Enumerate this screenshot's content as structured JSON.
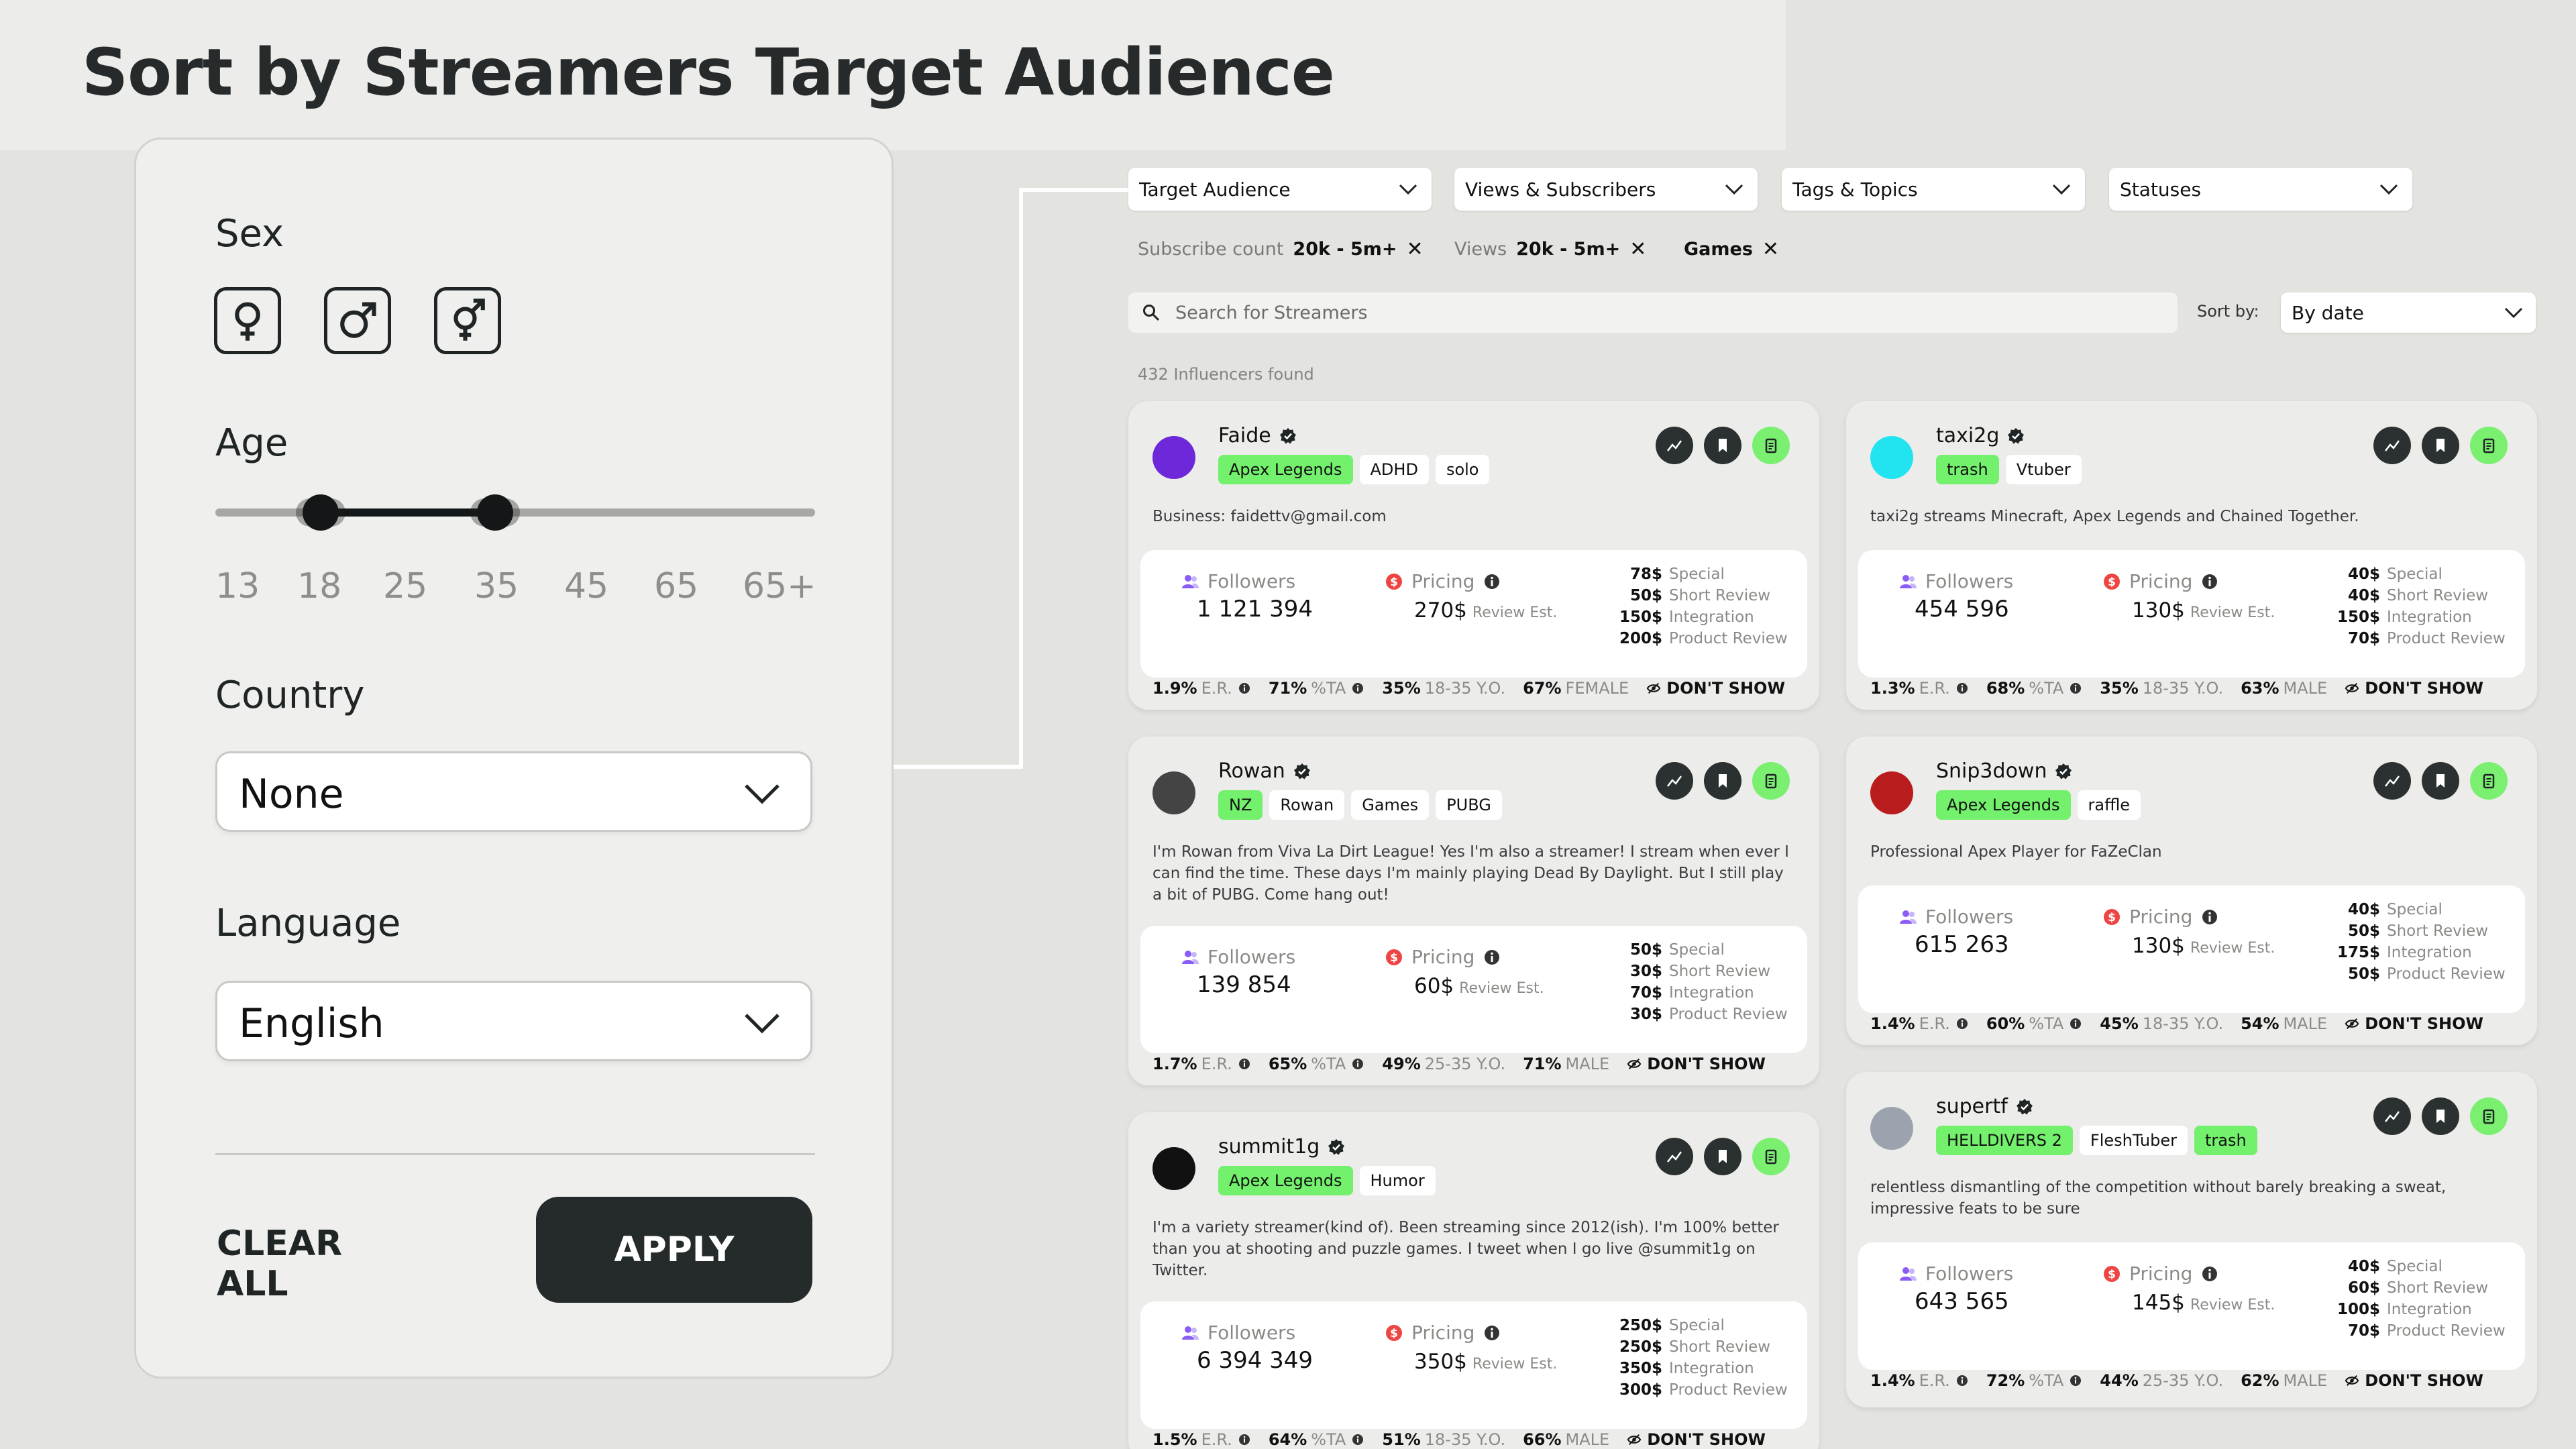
{
  "header": {
    "title": "Sort by Streamers Target Audience"
  },
  "filter_panel": {
    "sex_label": "Sex",
    "age_label": "Age",
    "age_ticks": [
      "13",
      "18",
      "25",
      "35",
      "45",
      "65",
      "65+"
    ],
    "age_range": [
      "18",
      "35"
    ],
    "country_label": "Country",
    "country_value": "None",
    "language_label": "Language",
    "language_value": "English",
    "clear_label": "CLEAR ALL",
    "apply_label": "APPLY"
  },
  "toolbar": {
    "dropdowns": [
      "Target Audience",
      "Views & Subscribers",
      "Tags & Topics",
      "Statuses"
    ],
    "chips": [
      {
        "label": "Subscribe count",
        "value": "20k - 5m+"
      },
      {
        "label": "Views",
        "value": "20k - 5m+"
      },
      {
        "label": "",
        "value": "Games"
      }
    ],
    "search_placeholder": "Search for Streamers",
    "sort_label": "Sort by:",
    "sort_value": "By date",
    "results_count": "432 Influencers found"
  },
  "labels": {
    "followers": "Followers",
    "pricing": "Pricing",
    "review_est": "Review Est.",
    "special": "Special",
    "short_review": "Short Review",
    "integration": "Integration",
    "product_review": "Product Review",
    "er": "E.R.",
    "ta": "%TA",
    "dont_show": "DON'T SHOW"
  },
  "colors": {
    "accent_green": "#73f06c",
    "dark": "#252b2b",
    "pricing_red": "#ef4444",
    "followers_purple": "#8b5cf6"
  },
  "cards": [
    {
      "name": "Faide",
      "tags": [
        "Apex Legends",
        "ADHD",
        "solo"
      ],
      "desc": "Business: faidettv@gmail.com",
      "followers": "1 121 394",
      "pricing": "270$",
      "prices": [
        "78$",
        "50$",
        "150$",
        "200$"
      ],
      "er": "1.9%",
      "ta": "71%",
      "age_pct": "35%",
      "age_range": "18-35 Y.O.",
      "gender_pct": "67%",
      "gender": "FEMALE"
    },
    {
      "name": "taxi2g",
      "tags": [
        "trash",
        "Vtuber"
      ],
      "desc": "taxi2g streams Minecraft, Apex Legends and Chained Together.",
      "followers": "454 596",
      "pricing": "130$",
      "prices": [
        "40$",
        "40$",
        "150$",
        "70$"
      ],
      "er": "1.3%",
      "ta": "68%",
      "age_pct": "35%",
      "age_range": "18-35 Y.O.",
      "gender_pct": "63%",
      "gender": "MALE"
    },
    {
      "name": "Rowan",
      "tags": [
        "NZ",
        "Rowan",
        "Games",
        "PUBG"
      ],
      "desc": "I'm Rowan from Viva La Dirt League! Yes I'm also a streamer! I stream when ever I can find the time. These days I'm mainly playing Dead By Daylight. But I still play a bit of PUBG. Come hang out!",
      "followers": "139 854",
      "pricing": "60$",
      "prices": [
        "50$",
        "30$",
        "70$",
        "30$"
      ],
      "er": "1.7%",
      "ta": "65%",
      "age_pct": "49%",
      "age_range": "25-35 Y.O.",
      "gender_pct": "71%",
      "gender": "MALE"
    },
    {
      "name": "Snip3down",
      "tags": [
        "Apex Legends",
        "raffle"
      ],
      "desc": "Professional Apex Player for FaZeClan",
      "followers": "615 263",
      "pricing": "130$",
      "prices": [
        "40$",
        "50$",
        "175$",
        "50$"
      ],
      "er": "1.4%",
      "ta": "60%",
      "age_pct": "45%",
      "age_range": "18-35 Y.O.",
      "gender_pct": "54%",
      "gender": "MALE"
    },
    {
      "name": "summit1g",
      "tags": [
        "Apex Legends",
        "Humor"
      ],
      "desc": "I'm a variety streamer(kind of). Been streaming since 2012(ish). I'm 100% better than you at shooting and puzzle games. I tweet when I go live @summit1g on Twitter.",
      "followers": "6 394 349",
      "pricing": "350$",
      "prices": [
        "250$",
        "250$",
        "350$",
        "300$"
      ],
      "er": "1.5%",
      "ta": "64%",
      "age_pct": "51%",
      "age_range": "18-35 Y.O.",
      "gender_pct": "66%",
      "gender": "MALE"
    },
    {
      "name": "supertf",
      "tags": [
        "HELLDIVERS 2",
        "FleshTuber",
        "trash"
      ],
      "desc": "relentless dismantling of the competition without barely breaking a sweat, impressive feats to be sure",
      "followers": "643 565",
      "pricing": "145$",
      "prices": [
        "40$",
        "60$",
        "100$",
        "70$"
      ],
      "er": "1.4%",
      "ta": "72%",
      "age_pct": "44%",
      "age_range": "25-35 Y.O.",
      "gender_pct": "62%",
      "gender": "MALE"
    }
  ]
}
